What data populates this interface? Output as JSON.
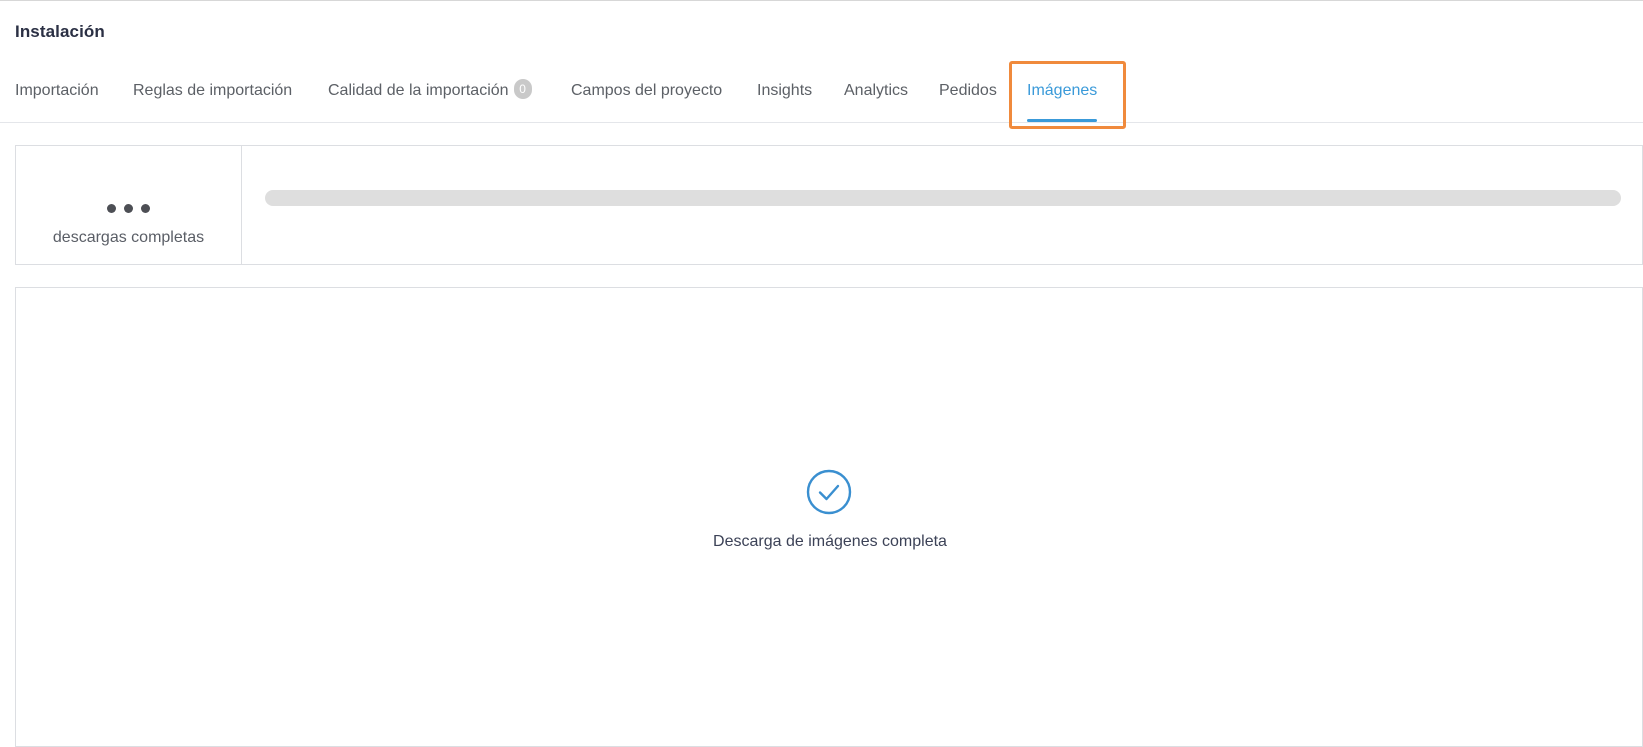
{
  "page": {
    "title": "Instalación"
  },
  "tabs": [
    {
      "label": "Importación"
    },
    {
      "label": "Reglas de importación"
    },
    {
      "label": "Calidad de la importación",
      "badge": "0"
    },
    {
      "label": "Campos del proyecto"
    },
    {
      "label": "Insights"
    },
    {
      "label": "Analytics"
    },
    {
      "label": "Pedidos"
    },
    {
      "label": "Imágenes",
      "active": true
    }
  ],
  "stats": {
    "value_icon": "ellipsis-icon",
    "label": "descargas completas",
    "progress_fraction": 0.0
  },
  "status": {
    "icon": "check-circle-icon",
    "message": "Descarga de imágenes completa"
  },
  "colors": {
    "accent": "#3a9ad9",
    "highlight": "#f08a3c",
    "badge": "#c9c9c9",
    "progress_track": "#dedede"
  }
}
